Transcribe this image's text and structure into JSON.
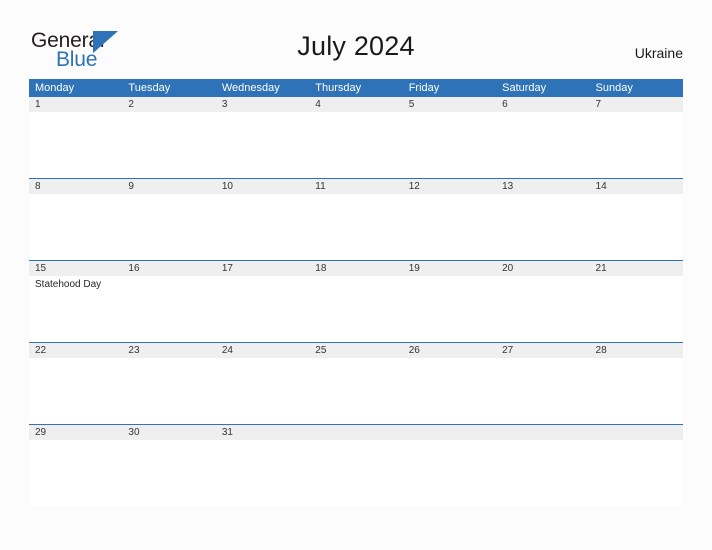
{
  "brand": {
    "name_top": "General",
    "name_bottom": "Blue",
    "flag_icon": "blue-triangle-flag-icon",
    "color_primary": "#2e72b8",
    "color_text": "#231f20"
  },
  "header": {
    "title": "July 2024",
    "locale": "Ukraine"
  },
  "calendar": {
    "month": "July",
    "year": "2024",
    "first_day_of_week": "Monday",
    "header_background": "#2e72b8",
    "day_band_background": "#efefef",
    "weekdays": [
      "Monday",
      "Tuesday",
      "Wednesday",
      "Thursday",
      "Friday",
      "Saturday",
      "Sunday"
    ],
    "weeks": [
      {
        "days": [
          {
            "number": "1",
            "events": []
          },
          {
            "number": "2",
            "events": []
          },
          {
            "number": "3",
            "events": []
          },
          {
            "number": "4",
            "events": []
          },
          {
            "number": "5",
            "events": []
          },
          {
            "number": "6",
            "events": []
          },
          {
            "number": "7",
            "events": []
          }
        ]
      },
      {
        "days": [
          {
            "number": "8",
            "events": []
          },
          {
            "number": "9",
            "events": []
          },
          {
            "number": "10",
            "events": []
          },
          {
            "number": "11",
            "events": []
          },
          {
            "number": "12",
            "events": []
          },
          {
            "number": "13",
            "events": []
          },
          {
            "number": "14",
            "events": []
          }
        ]
      },
      {
        "days": [
          {
            "number": "15",
            "events": [
              "Statehood Day"
            ]
          },
          {
            "number": "16",
            "events": []
          },
          {
            "number": "17",
            "events": []
          },
          {
            "number": "18",
            "events": []
          },
          {
            "number": "19",
            "events": []
          },
          {
            "number": "20",
            "events": []
          },
          {
            "number": "21",
            "events": []
          }
        ]
      },
      {
        "days": [
          {
            "number": "22",
            "events": []
          },
          {
            "number": "23",
            "events": []
          },
          {
            "number": "24",
            "events": []
          },
          {
            "number": "25",
            "events": []
          },
          {
            "number": "26",
            "events": []
          },
          {
            "number": "27",
            "events": []
          },
          {
            "number": "28",
            "events": []
          }
        ]
      },
      {
        "days": [
          {
            "number": "29",
            "events": []
          },
          {
            "number": "30",
            "events": []
          },
          {
            "number": "31",
            "events": []
          },
          {
            "number": "",
            "events": []
          },
          {
            "number": "",
            "events": []
          },
          {
            "number": "",
            "events": []
          },
          {
            "number": "",
            "events": []
          }
        ]
      }
    ]
  }
}
